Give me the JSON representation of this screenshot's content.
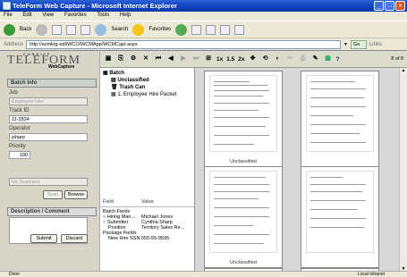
{
  "window": {
    "title": "TeleForm Web Capture - Microsoft Internet Explorer"
  },
  "menu": [
    "File",
    "Edit",
    "View",
    "Favorites",
    "Tools",
    "Help"
  ],
  "toolbar": {
    "back": "Back",
    "search": "Search",
    "favorites": "Favorites"
  },
  "address": {
    "label": "Address",
    "url": "http://avmktg-edl/WCO/WCMApp/WCMCapt.aspx",
    "go": "Go",
    "links": "Links"
  },
  "logo": {
    "top": "CARDIFF",
    "main": "TELEFORM",
    "sub": "WebCapture"
  },
  "batch_info": {
    "header": "Batch Info",
    "job_label": "Job",
    "job_value": "Employee Hire",
    "track_label": "Track ID",
    "track_value": "11-2834",
    "operator_label": "Operator",
    "operator_value": "jsharp",
    "priority_label": "Priority",
    "priority_value": "100",
    "scanner_value": "No Scanners",
    "scan_btn": "Scan",
    "browse_btn": "Browse"
  },
  "description": {
    "header": "Description / Comment",
    "submit": "Submit",
    "discard": "Discard"
  },
  "viewer": {
    "zoom1": "1x",
    "zoom15": "1.5",
    "zoom2": "2x",
    "help": "?",
    "page_of": "8 of 8"
  },
  "tree": {
    "batch": "Batch",
    "unclassified": "Unclassified",
    "trash": "Trash Can",
    "packet": "1. Employee Hire Packet"
  },
  "fields": {
    "col_field": "Field",
    "col_value": "Value",
    "rows": [
      {
        "field": "Batch Fields",
        "value": ""
      },
      {
        "field": "Hiring Man...",
        "value": "Michael Jones"
      },
      {
        "field": "Submitter",
        "value": "Cynthia Sharp"
      },
      {
        "field": "Position",
        "value": "Territory Sales Re..."
      },
      {
        "field": "Package Fields",
        "value": ""
      },
      {
        "field": "New Hire SSN",
        "value": "555-55-9595"
      }
    ]
  },
  "thumbnails": [
    "Unclassified",
    "",
    "Unclassified",
    "",
    "",
    ""
  ],
  "status": {
    "left": "Done",
    "right": "Local intranet"
  }
}
